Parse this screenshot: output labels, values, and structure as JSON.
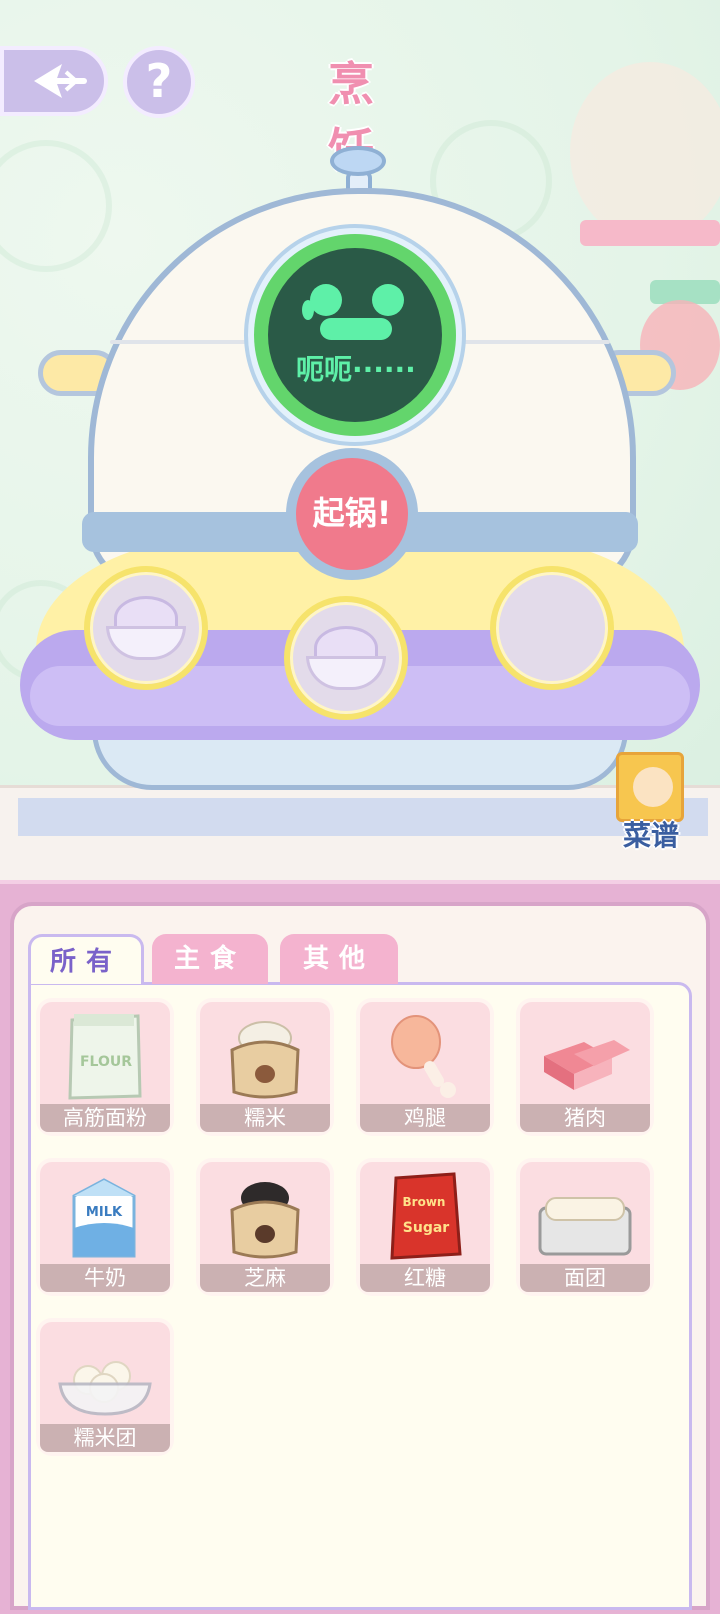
{
  "header": {
    "title": "烹 饪",
    "help_glyph": "?"
  },
  "cooker": {
    "screen_text": "呃呃······",
    "cook_button_label": "起锅!",
    "slots": [
      {
        "filled": true,
        "content": "cream-bowl"
      },
      {
        "filled": true,
        "content": "cream-bowl"
      },
      {
        "filled": false,
        "content": ""
      }
    ]
  },
  "recipe_book": {
    "label": "菜谱"
  },
  "tabs": [
    {
      "label": "所有",
      "active": true
    },
    {
      "label": "主食",
      "active": false
    },
    {
      "label": "其他",
      "active": false
    }
  ],
  "ingredients": [
    {
      "label": "高筋面粉",
      "icon": "flour-bag-icon"
    },
    {
      "label": "糯米",
      "icon": "rice-sack-icon"
    },
    {
      "label": "鸡腿",
      "icon": "chicken-leg-icon"
    },
    {
      "label": "猪肉",
      "icon": "pork-icon"
    },
    {
      "label": "牛奶",
      "icon": "milk-carton-icon"
    },
    {
      "label": "芝麻",
      "icon": "sesame-sack-icon"
    },
    {
      "label": "红糖",
      "icon": "brown-sugar-icon"
    },
    {
      "label": "面团",
      "icon": "dough-tray-icon"
    },
    {
      "label": "糯米团",
      "icon": "rice-ball-bowl-icon"
    }
  ],
  "item_art_text": {
    "flour": "FLOUR",
    "milk": "MILK",
    "brown": "Brown",
    "sugar": "Sugar"
  },
  "colors": {
    "title_pink": "#f08fb0",
    "tab_active_text": "#7a62c9",
    "screen_green": "#5ef0a8",
    "cook_button": "#f07a8c"
  }
}
